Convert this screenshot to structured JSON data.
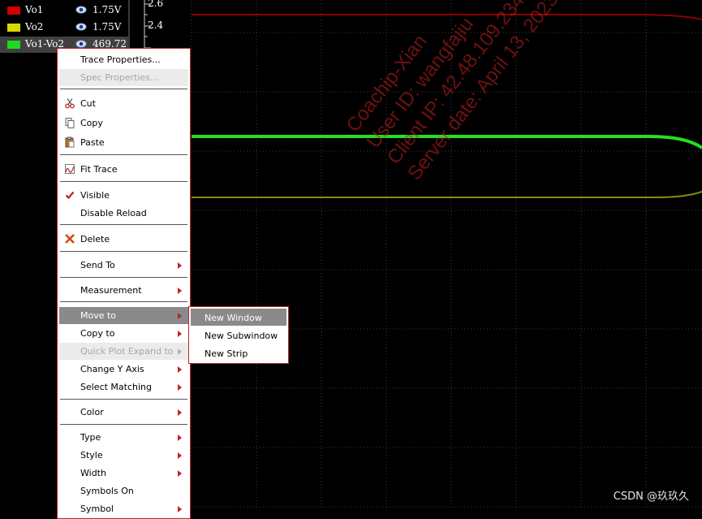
{
  "legend": {
    "rows": [
      {
        "name": "Vo1",
        "color": "#d10000",
        "value": "1.75V",
        "selected": false
      },
      {
        "name": "Vo2",
        "color": "#d8d800",
        "value": "1.75V",
        "selected": false
      },
      {
        "name": "Vo1-Vo2",
        "color": "#22d822",
        "value": "469.72",
        "selected": true
      }
    ]
  },
  "yaxis": {
    "ticks": [
      "2.6",
      "2.4"
    ]
  },
  "context_menu": {
    "trace_properties": "Trace Properties...",
    "spec_properties": "Spec Properties...",
    "cut": "Cut",
    "copy": "Copy",
    "paste": "Paste",
    "fit_trace": "Fit Trace",
    "visible": "Visible",
    "disable_reload": "Disable Reload",
    "delete": "Delete",
    "send_to": "Send To",
    "measurement": "Measurement",
    "move_to": "Move to",
    "copy_to": "Copy to",
    "quick_plot_expand_to": "Quick Plot Expand to",
    "change_y_axis": "Change Y Axis",
    "select_matching": "Select Matching",
    "color": "Color",
    "type": "Type",
    "style": "Style",
    "width": "Width",
    "symbols_on": "Symbols On",
    "symbol": "Symbol"
  },
  "submenu": {
    "new_window": "New Window",
    "new_subwindow": "New Subwindow",
    "new_strip": "New Strip"
  },
  "watermark": {
    "line1": "Coachip-Xian",
    "line2": "User ID: wangfajiu",
    "line3": "Client IP: 42.48.109.234",
    "line4": "Server date: April 13, 2023"
  },
  "credit": "CSDN @玖玖久",
  "colors": {
    "menu_border": "#b9252b",
    "trace_vo1": "#d10000",
    "trace_vo2": "#d8d800",
    "trace_diff": "#22d822",
    "menu_highlight": "#8a8a8a"
  }
}
